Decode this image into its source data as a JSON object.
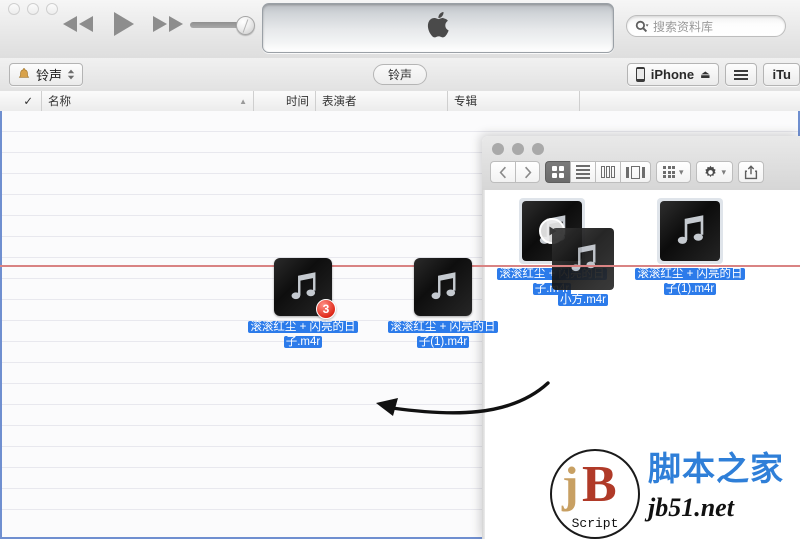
{
  "itunes": {
    "window_name": "iTunes",
    "traffic_lights": [
      "close",
      "minimize",
      "zoom"
    ],
    "transport": {
      "rewind_label": "Rewind",
      "play_label": "Play",
      "fastforward_label": "Fast Forward"
    },
    "volume": {
      "value": 85,
      "label": "Volume"
    },
    "display": {
      "logo": "apple-logo"
    },
    "search": {
      "placeholder": "搜索资料库",
      "value": "",
      "icon": "search-icon"
    },
    "toolbar": {
      "library_popup": {
        "label": "铃声",
        "icon": "bell-icon"
      },
      "center_pill": "铃声",
      "device_button": {
        "label": "iPhone",
        "icon": "iphone-icon",
        "eject": "⏏"
      },
      "list_button_icon": "hamburger-icon",
      "store_button": "iTu"
    },
    "columns": [
      {
        "key": "check",
        "label": "✓"
      },
      {
        "key": "name",
        "label": "名称",
        "sorted": "▲"
      },
      {
        "key": "time",
        "label": "时间"
      },
      {
        "key": "artist",
        "label": "表演者"
      },
      {
        "key": "album",
        "label": "专辑"
      }
    ],
    "track_rows": [],
    "drop_target_active": true
  },
  "drag": {
    "items": [
      {
        "label_line1": "滚滚红尘 + 闪亮的日",
        "label_line2": "子.m4r",
        "badge": "3",
        "icon": "music-file-icon"
      },
      {
        "label_line1": "滚滚红尘 + 闪亮的日",
        "label_line2": "子(1).m4r",
        "badge": "",
        "icon": "music-file-icon"
      }
    ],
    "arrow": "curved-drag-arrow"
  },
  "finder": {
    "window_name": "Finder",
    "traffic_lights": [
      "close",
      "minimize",
      "zoom"
    ],
    "toolbar": {
      "back_icon": "chevron-left-icon",
      "forward_icon": "chevron-right-icon",
      "view_icon_grid": "icon-view-icon",
      "view_list": "list-view-icon",
      "view_column": "column-view-icon",
      "view_coverflow": "coverflow-view-icon",
      "arrange_icon": "arrange-icon",
      "action_icon": "gear-icon",
      "share_icon": "share-icon",
      "selected_view": "icon-view-icon"
    },
    "files": [
      {
        "label_line1": "滚滚红尘 + 闪亮的日",
        "label_line2": "子.m4r",
        "icon": "music-file-icon",
        "overlay": "play-icon",
        "selected": true
      },
      {
        "label_line1": "滚滚红尘 + 闪亮的日",
        "label_line2": "子(1).m4r",
        "icon": "music-file-icon",
        "overlay": "",
        "selected": true
      },
      {
        "label_line1": "小方.m4r",
        "label_line2": "",
        "icon": "music-file-icon",
        "overlay": "",
        "selected": true
      }
    ]
  },
  "watermark": {
    "mark": "B",
    "sub": "Script",
    "site_cn": "脚本之家",
    "site_url": "jb51.net"
  },
  "colors": {
    "selection_blue": "#2c7bea",
    "drop_border": "#6f8fd0",
    "guide_red": "#d98383",
    "badge_red": "#e02b1b"
  }
}
